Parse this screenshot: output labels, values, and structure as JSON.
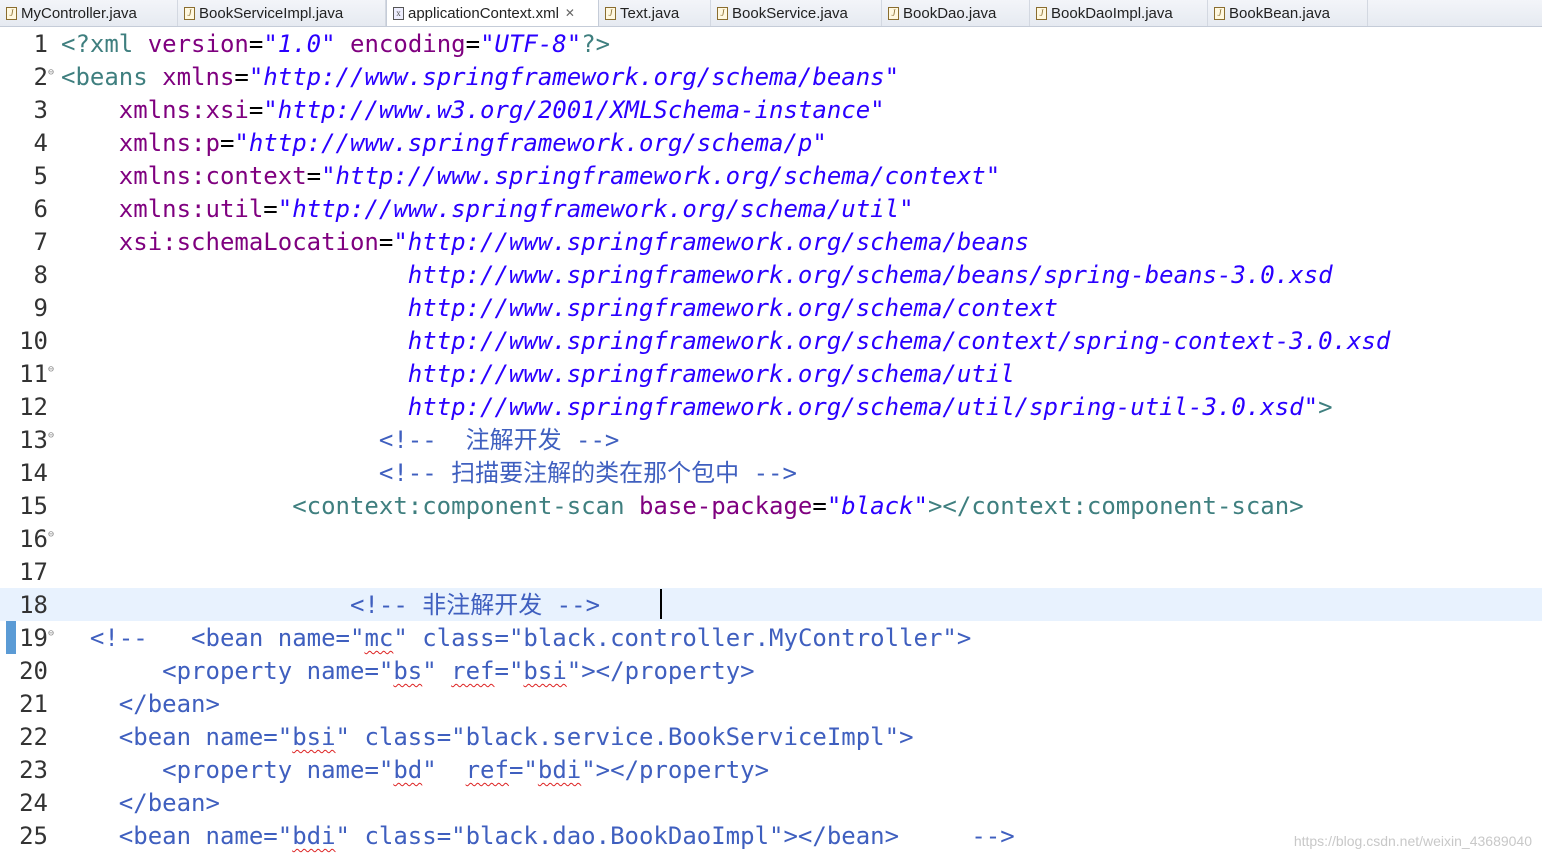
{
  "tabs": [
    {
      "label": "MyController.java",
      "kind": "java",
      "active": false
    },
    {
      "label": "BookServiceImpl.java",
      "kind": "java",
      "active": false
    },
    {
      "label": "applicationContext.xml",
      "kind": "xml",
      "active": true,
      "close": "✕"
    },
    {
      "label": "Text.java",
      "kind": "java",
      "active": false
    },
    {
      "label": "BookService.java",
      "kind": "java",
      "active": false
    },
    {
      "label": "BookDao.java",
      "kind": "java",
      "active": false
    },
    {
      "label": "BookDaoImpl.java",
      "kind": "java",
      "active": false
    },
    {
      "label": "BookBean.java",
      "kind": "java",
      "active": false
    }
  ],
  "editor": {
    "current_line": 18,
    "lines": [
      {
        "n": "1",
        "segs": [
          [
            "pi",
            "<?xml "
          ],
          [
            "attr",
            "version"
          ],
          [
            "plain",
            "="
          ],
          [
            "val",
            "\"1.0\""
          ],
          [
            "plain",
            " "
          ],
          [
            "attr",
            "encoding"
          ],
          [
            "plain",
            "="
          ],
          [
            "val",
            "\"UTF-8\""
          ],
          [
            "pi",
            "?>"
          ]
        ]
      },
      {
        "n": "2",
        "fold": true,
        "segs": [
          [
            "tag",
            "<beans "
          ],
          [
            "attr",
            "xmlns"
          ],
          [
            "plain",
            "="
          ],
          [
            "val",
            "\"http://www.springframework.org/schema/beans\""
          ]
        ]
      },
      {
        "n": "3",
        "segs": [
          [
            "plain",
            "    "
          ],
          [
            "attr",
            "xmlns:xsi"
          ],
          [
            "plain",
            "="
          ],
          [
            "val",
            "\"http://www.w3.org/2001/XMLSchema-instance\""
          ]
        ]
      },
      {
        "n": "4",
        "segs": [
          [
            "plain",
            "    "
          ],
          [
            "attr",
            "xmlns:p"
          ],
          [
            "plain",
            "="
          ],
          [
            "val",
            "\"http://www.springframework.org/schema/p\""
          ]
        ]
      },
      {
        "n": "5",
        "segs": [
          [
            "plain",
            "    "
          ],
          [
            "attr",
            "xmlns:context"
          ],
          [
            "plain",
            "="
          ],
          [
            "val",
            "\"http://www.springframework.org/schema/context\""
          ]
        ]
      },
      {
        "n": "6",
        "segs": [
          [
            "plain",
            "    "
          ],
          [
            "attr",
            "xmlns:util"
          ],
          [
            "plain",
            "="
          ],
          [
            "val",
            "\"http://www.springframework.org/schema/util\""
          ]
        ]
      },
      {
        "n": "7",
        "segs": [
          [
            "plain",
            "    "
          ],
          [
            "attr",
            "xsi:schemaLocation"
          ],
          [
            "plain",
            "="
          ],
          [
            "val",
            "\"http://www.springframework.org/schema/beans"
          ]
        ]
      },
      {
        "n": "8",
        "segs": [
          [
            "plain",
            "                        "
          ],
          [
            "val",
            "http://www.springframework.org/schema/beans/spring-beans-3.0.xsd"
          ]
        ]
      },
      {
        "n": "9",
        "segs": [
          [
            "plain",
            "                        "
          ],
          [
            "val",
            "http://www.springframework.org/schema/context"
          ]
        ]
      },
      {
        "n": "10",
        "segs": [
          [
            "plain",
            "                        "
          ],
          [
            "val",
            "http://www.springframework.org/schema/context/spring-context-3.0.xsd"
          ]
        ]
      },
      {
        "n": "11",
        "fold": true,
        "segs": [
          [
            "plain",
            "                        "
          ],
          [
            "val",
            "http://www.springframework.org/schema/util"
          ]
        ]
      },
      {
        "n": "12",
        "segs": [
          [
            "plain",
            "                        "
          ],
          [
            "val",
            "http://www.springframework.org/schema/util/spring-util-3.0.xsd\""
          ],
          [
            "tag",
            ">"
          ]
        ]
      },
      {
        "n": "13",
        "fold": true,
        "segs": [
          [
            "plain",
            "                      "
          ],
          [
            "cmt",
            "<!--  注解开发 -->"
          ]
        ]
      },
      {
        "n": "14",
        "segs": [
          [
            "plain",
            "                      "
          ],
          [
            "cmt",
            "<!-- 扫描要注解的类在那个包中 -->"
          ]
        ]
      },
      {
        "n": "15",
        "segs": [
          [
            "plain",
            "                "
          ],
          [
            "tag",
            "<context:component-scan "
          ],
          [
            "attr",
            "base-package"
          ],
          [
            "plain",
            "="
          ],
          [
            "val",
            "\"black\""
          ],
          [
            "tag",
            "></context:component-scan>"
          ]
        ]
      },
      {
        "n": "16",
        "fold": true,
        "segs": []
      },
      {
        "n": "17",
        "segs": []
      },
      {
        "n": "18",
        "segs": [
          [
            "plain",
            "                    "
          ],
          [
            "cmt",
            "<!-- 非注解开发 -->"
          ]
        ]
      },
      {
        "n": "19",
        "fold": true,
        "segs": [
          [
            "plain",
            "  "
          ],
          [
            "cmt",
            "<!--   <bean name=\""
          ],
          [
            "cmts",
            "mc"
          ],
          [
            "cmt",
            "\" class=\"black.controller.MyController\">"
          ]
        ]
      },
      {
        "n": "20",
        "segs": [
          [
            "plain",
            "       "
          ],
          [
            "cmt",
            "<property name=\""
          ],
          [
            "cmts",
            "bs"
          ],
          [
            "cmt",
            "\" "
          ],
          [
            "cmts",
            "ref"
          ],
          [
            "cmt",
            "=\""
          ],
          [
            "cmts",
            "bsi"
          ],
          [
            "cmt",
            "\"></property>"
          ]
        ]
      },
      {
        "n": "21",
        "segs": [
          [
            "plain",
            "    "
          ],
          [
            "cmt",
            "</bean>"
          ]
        ]
      },
      {
        "n": "22",
        "segs": [
          [
            "plain",
            "    "
          ],
          [
            "cmt",
            "<bean name=\""
          ],
          [
            "cmts",
            "bsi"
          ],
          [
            "cmt",
            "\" class=\"black.service.BookServiceImpl\">"
          ]
        ]
      },
      {
        "n": "23",
        "segs": [
          [
            "plain",
            "       "
          ],
          [
            "cmt",
            "<property name=\""
          ],
          [
            "cmts",
            "bd"
          ],
          [
            "cmt",
            "\"  "
          ],
          [
            "cmts",
            "ref"
          ],
          [
            "cmt",
            "=\""
          ],
          [
            "cmts",
            "bdi"
          ],
          [
            "cmt",
            "\"></property>"
          ]
        ]
      },
      {
        "n": "24",
        "segs": [
          [
            "plain",
            "    "
          ],
          [
            "cmt",
            "</bean>"
          ]
        ]
      },
      {
        "n": "25",
        "segs": [
          [
            "plain",
            "    "
          ],
          [
            "cmt",
            "<bean name=\""
          ],
          [
            "cmts",
            "bdi"
          ],
          [
            "cmt",
            "\" class=\"black.dao.BookDaoImpl\"></bean>     -->"
          ]
        ]
      }
    ]
  },
  "watermark": "https://blog.csdn.net/weixin_43689040"
}
